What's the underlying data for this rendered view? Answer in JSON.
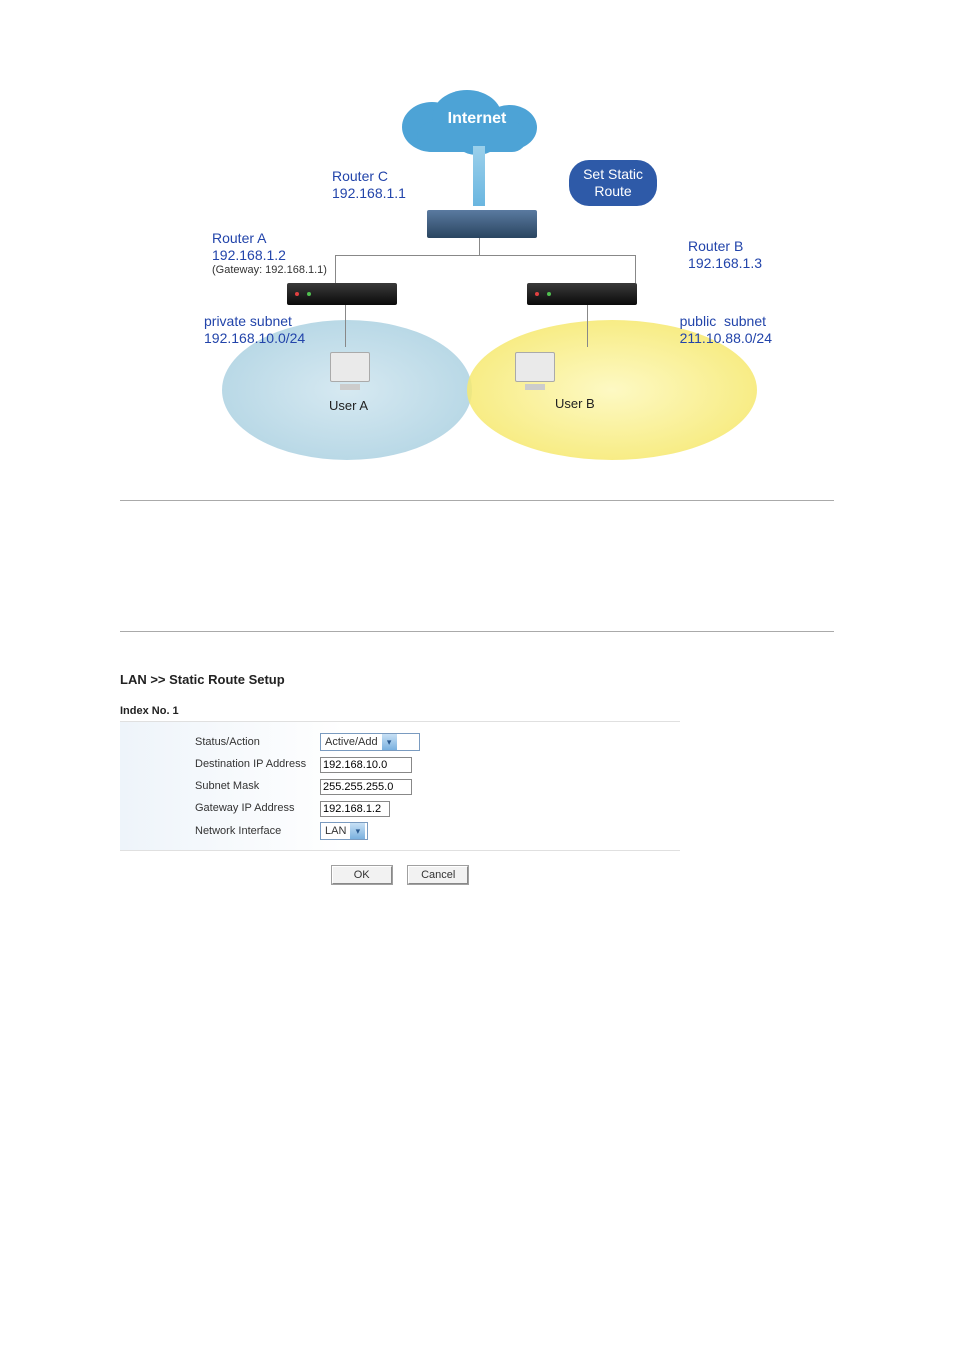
{
  "diagram": {
    "cloud_label": "Internet",
    "callout": "Set Static\nRoute",
    "router_c": {
      "name": "Router C",
      "ip": "192.168.1.1"
    },
    "router_a": {
      "name": "Router A",
      "ip": "192.168.1.2",
      "gateway_note": "(Gateway: 192.168.1.1)"
    },
    "router_b": {
      "name": "Router B",
      "ip": "192.168.1.3"
    },
    "subnet_a": {
      "name": "private subnet",
      "cidr": "192.168.10.0/24"
    },
    "subnet_b": {
      "name": "public  subnet",
      "cidr": "211.10.88.0/24"
    },
    "user_a": "User A",
    "user_b": "User B"
  },
  "form": {
    "breadcrumb": "LAN >> Static Route Setup",
    "index_label": "Index No. 1",
    "rows": {
      "status_label": "Status/Action",
      "status_value": "Active/Add",
      "dest_label": "Destination IP Address",
      "dest_value": "192.168.10.0",
      "mask_label": "Subnet Mask",
      "mask_value": "255.255.255.0",
      "gw_label": "Gateway IP Address",
      "gw_value": "192.168.1.2",
      "iface_label": "Network Interface",
      "iface_value": "LAN"
    },
    "buttons": {
      "ok": "OK",
      "cancel": "Cancel"
    }
  }
}
